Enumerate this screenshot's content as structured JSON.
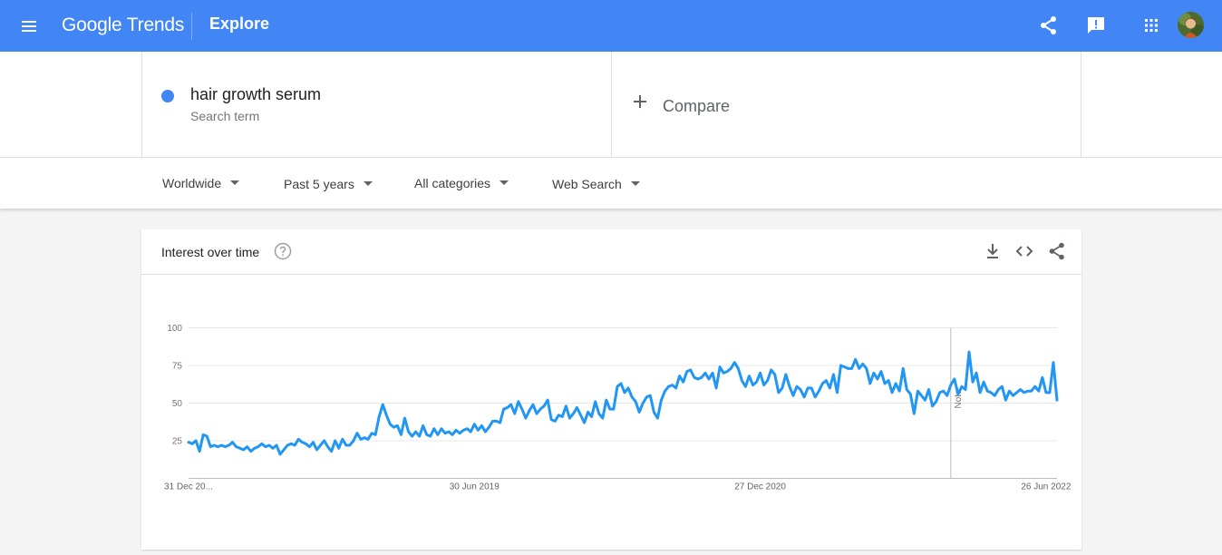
{
  "header": {
    "brand_google": "Google",
    "brand_trends": "Trends",
    "section": "Explore"
  },
  "search": {
    "term": "hair growth serum",
    "term_type": "Search term",
    "term_color": "#4285f4",
    "compare_label": "Compare"
  },
  "filters": {
    "region": "Worldwide",
    "time": "Past 5 years",
    "category": "All categories",
    "property": "Web Search"
  },
  "card": {
    "title": "Interest over time"
  },
  "icons": {
    "menu": "hamburger-menu-icon",
    "share": "share-icon",
    "feedback": "feedback-icon",
    "apps": "apps-grid-icon",
    "help": "help-circle-icon",
    "download": "download-icon",
    "embed": "embed-code-icon",
    "card_share": "share-icon"
  },
  "chart_data": {
    "type": "line",
    "title": "",
    "xlabel": "",
    "ylabel": "",
    "ylim": [
      0,
      100
    ],
    "y_ticks": [
      25,
      50,
      75,
      100
    ],
    "x_tick_labels": [
      "31 Dec 20...",
      "30 Jun 2019",
      "27 Dec 2020",
      "26 Jun 2022"
    ],
    "x_tick_weeks": [
      0,
      78,
      156,
      234
    ],
    "note_label": "Note",
    "note_week": 208,
    "grid": true,
    "series": [
      {
        "color": "#2196f3",
        "values": [
          24,
          23,
          25,
          18,
          29,
          28,
          21,
          22,
          21,
          22,
          21,
          22,
          24,
          21,
          20,
          19,
          21,
          18,
          20,
          21,
          23,
          21,
          22,
          20,
          22,
          16,
          19,
          22,
          23,
          22,
          26,
          24,
          23,
          21,
          24,
          19,
          22,
          25,
          21,
          18,
          25,
          20,
          26,
          22,
          22,
          25,
          30,
          26,
          27,
          26,
          30,
          29,
          41,
          49,
          42,
          36,
          34,
          35,
          29,
          40,
          31,
          28,
          31,
          28,
          35,
          29,
          28,
          33,
          29,
          33,
          30,
          31,
          29,
          32,
          30,
          32,
          33,
          31,
          36,
          32,
          35,
          31,
          34,
          38,
          38,
          37,
          46,
          47,
          49,
          43,
          51,
          46,
          40,
          45,
          49,
          43,
          46,
          48,
          52,
          39,
          38,
          42,
          41,
          48,
          40,
          43,
          47,
          42,
          37,
          44,
          41,
          51,
          43,
          40,
          52,
          46,
          46,
          61,
          63,
          57,
          60,
          54,
          51,
          44,
          50,
          54,
          55,
          44,
          40,
          52,
          58,
          61,
          62,
          60,
          68,
          64,
          71,
          72,
          67,
          66,
          67,
          70,
          66,
          70,
          60,
          74,
          70,
          71,
          73,
          77,
          73,
          65,
          61,
          68,
          62,
          64,
          70,
          62,
          65,
          72,
          69,
          57,
          60,
          69,
          61,
          55,
          61,
          59,
          54,
          60,
          60,
          54,
          58,
          63,
          65,
          60,
          69,
          57,
          75,
          74,
          73,
          73,
          79,
          73,
          76,
          73,
          63,
          70,
          66,
          71,
          63,
          65,
          57,
          63,
          58,
          73,
          59,
          56,
          43,
          58,
          55,
          52,
          59,
          48,
          51,
          57,
          58,
          55,
          62,
          66,
          56,
          61,
          59,
          84,
          64,
          70,
          57,
          64,
          58,
          57,
          55,
          59,
          61,
          52,
          58,
          55,
          57,
          59,
          57,
          58,
          58,
          61,
          58,
          67,
          57,
          57,
          77,
          52
        ]
      }
    ]
  }
}
